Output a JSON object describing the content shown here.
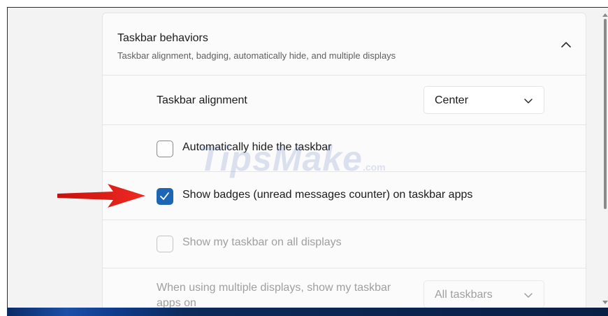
{
  "section": {
    "title": "Taskbar behaviors",
    "subtitle": "Taskbar alignment, badging, automatically hide, and multiple displays"
  },
  "alignment": {
    "label": "Taskbar alignment",
    "value": "Center"
  },
  "options": {
    "auto_hide": {
      "label": "Automatically hide the taskbar",
      "checked": false
    },
    "badges": {
      "label": "Show badges (unread messages counter) on taskbar apps",
      "checked": true
    },
    "all_displays": {
      "label": "Show my taskbar on all displays",
      "checked": false,
      "disabled": true
    }
  },
  "multi_display": {
    "label": "When using multiple displays, show my taskbar apps on",
    "value": "All taskbars"
  },
  "watermark": {
    "brand": "TipsMake",
    "suffix": ".com"
  },
  "colors": {
    "accent": "#1d66b6",
    "arrow": "#e0201b",
    "disabled_text": "#9f9f9f"
  },
  "icons": {
    "collapse": "chevron-up-icon",
    "dropdown": "chevron-down-icon",
    "check": "checkmark-icon",
    "pointer": "red-arrow-icon"
  }
}
